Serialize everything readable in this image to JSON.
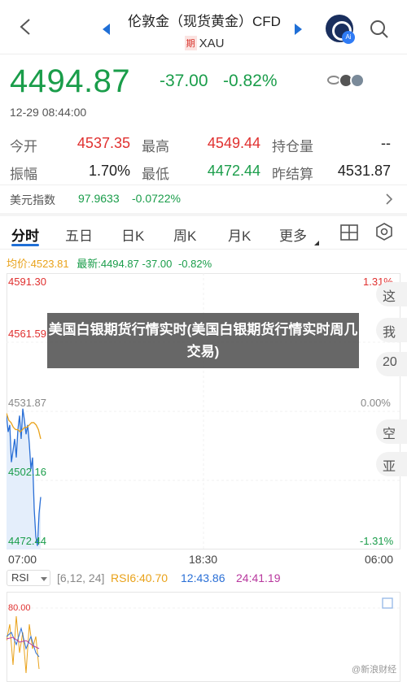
{
  "header": {
    "title": "伦敦金（现货黄金）CFD",
    "tag": "期",
    "symbol": "XAU",
    "ai_badge": "Ai"
  },
  "quote": {
    "price": "4494.87",
    "change": "-37.00",
    "change_pct": "-0.82%",
    "datetime": "12-29 08:44:00"
  },
  "stats": [
    {
      "label": "今开",
      "value": "4537.35",
      "color": "#e0302f"
    },
    {
      "label": "最高",
      "value": "4549.44",
      "color": "#e0302f"
    },
    {
      "label": "持仓量",
      "value": "--",
      "color": "#222222"
    },
    {
      "label": "振幅",
      "value": "1.70%",
      "color": "#222222"
    },
    {
      "label": "最低",
      "value": "4472.44",
      "color": "#1a9d4a"
    },
    {
      "label": "昨结算",
      "value": "4531.87",
      "color": "#222222"
    }
  ],
  "usd_index": {
    "label": "美元指数",
    "value": "97.9633",
    "change": "-0.0722%"
  },
  "tabs": [
    {
      "label": "分时"
    },
    {
      "label": "五日"
    },
    {
      "label": "日K"
    },
    {
      "label": "周K"
    },
    {
      "label": "月K"
    },
    {
      "label": "更多"
    }
  ],
  "chart_legend": {
    "avg": "均价:4523.81",
    "latest": "最新:4494.87",
    "change": "-37.00",
    "pct": "-0.82%"
  },
  "y_labels": [
    "4591.30",
    "4561.59",
    "4531.87",
    "4502.16",
    "4472.44"
  ],
  "pct_labels": [
    "1.31%",
    "0.00%",
    "-1.31%"
  ],
  "x_labels": [
    "07:00",
    "18:30",
    "06:00"
  ],
  "side_buttons": [
    "这",
    "我",
    "20",
    "空",
    "亚"
  ],
  "overlay_text": "美国白银期货行情实时(美国白银期货行情实时周几交易)",
  "rsi": {
    "selector": "RSI",
    "params": "[6,12, 24]",
    "rsi6": "RSI6:40.70",
    "rsi12": "12:43.86",
    "rsi24": "24:41.19",
    "axis_top": "80.00"
  },
  "watermark": "@新浪财经",
  "chart_data": {
    "type": "line",
    "ylim": [
      4472.44,
      4591.3
    ],
    "series": [
      {
        "values": [
          4530,
          4523,
          4526,
          4510,
          4515,
          4520,
          4512,
          4524,
          4530,
          4520,
          4533,
          4528,
          4522,
          4526,
          4518,
          4507,
          4512,
          4490,
          4478,
          4474,
          4488,
          4495
        ]
      },
      {
        "values": [
          4531,
          4528,
          4527,
          4525,
          4524,
          4524,
          4523,
          4524,
          4525,
          4525,
          4526,
          4527,
          4527,
          4526,
          4524,
          4520
        ]
      }
    ]
  }
}
